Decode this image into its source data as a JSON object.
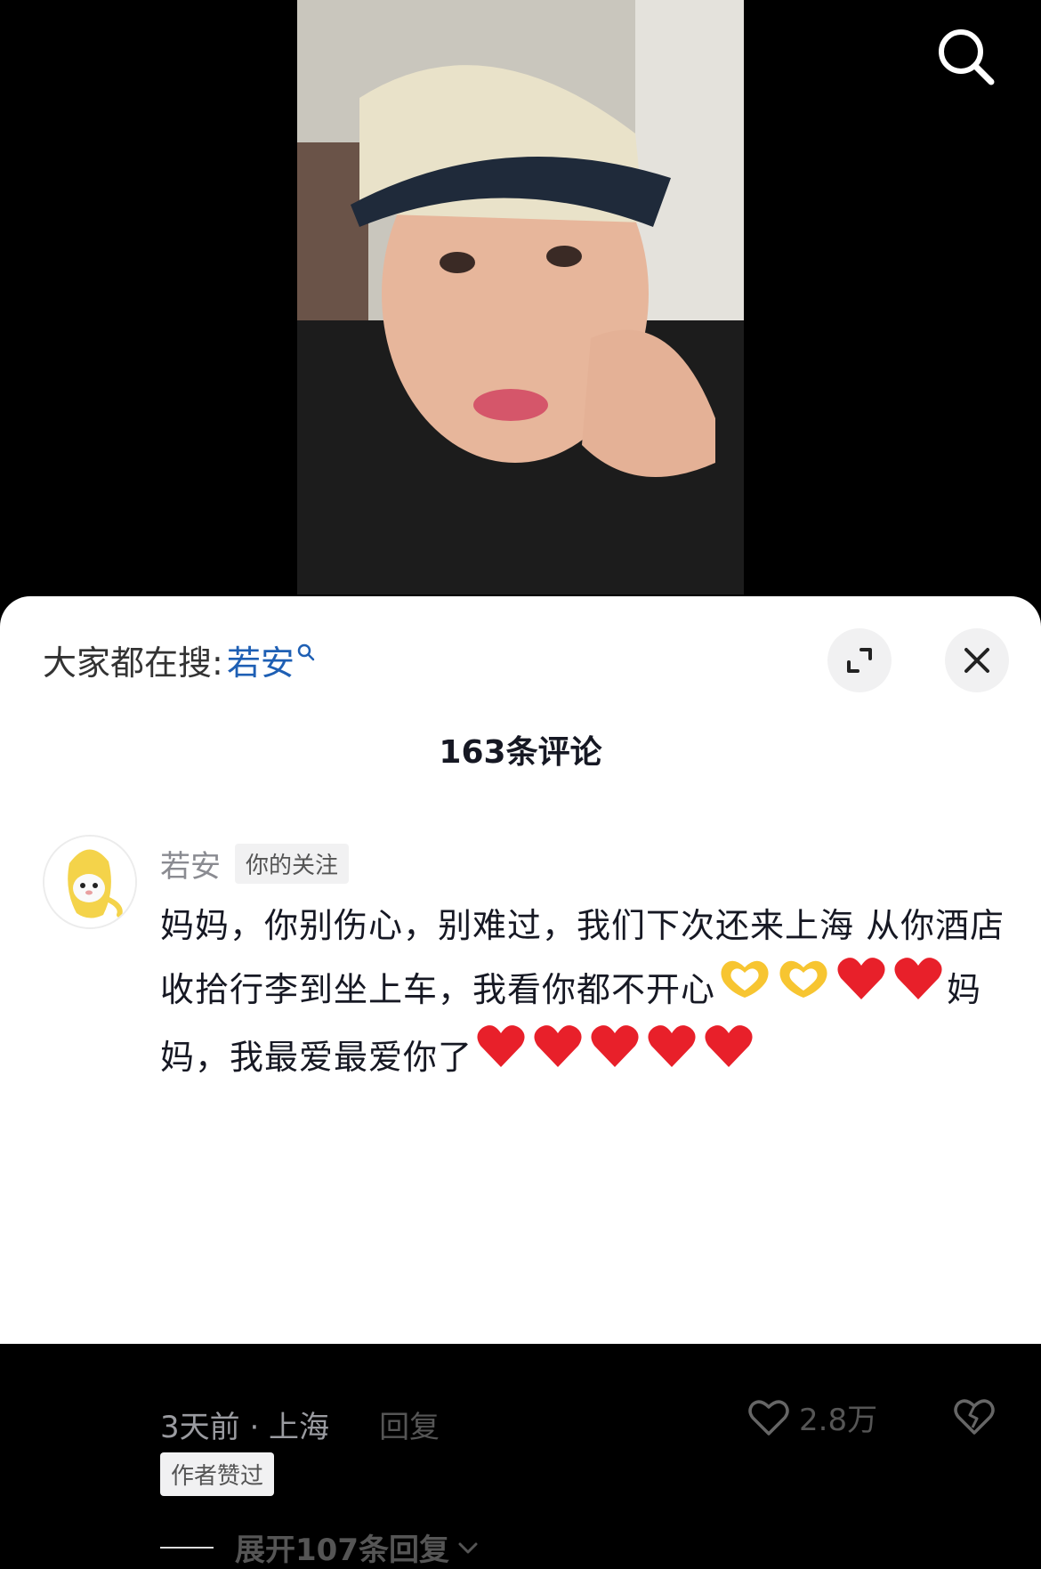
{
  "trending": {
    "prefix": "大家都在搜:",
    "term": "若安"
  },
  "comments_count_label": "163条评论",
  "comment": {
    "username": "若安",
    "follow_tag": "你的关注",
    "text_part1": "妈妈，你别伤心，别难过，我们下次还来上海 从你酒店收拾行李到坐上车，我看你都不开心",
    "text_part2": "妈妈，我最爱最爱你了",
    "time_location": "3天前 · 上海",
    "reply_label": "回复",
    "like_count": "2.8万",
    "author_tag": "作者赞过",
    "expand_replies_label": "展开107条回复"
  },
  "colors": {
    "accent_link": "#1e5fb4",
    "heart": "#e8202a",
    "hands": "#f7c531"
  },
  "icons": [
    "search-icon",
    "expand-icon",
    "close-icon",
    "heart-outline-icon",
    "broken-heart-icon",
    "chevron-down-icon",
    "heart-hands-emoji",
    "red-heart-emoji"
  ]
}
